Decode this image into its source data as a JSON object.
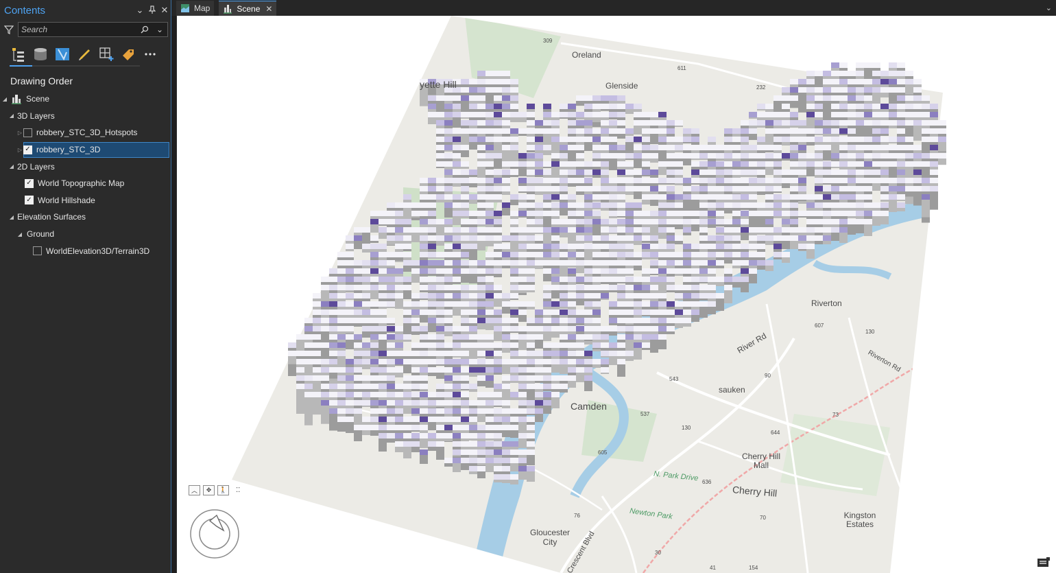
{
  "contents": {
    "title": "Contents",
    "search": {
      "placeholder": "Search"
    },
    "section_title": "Drawing Order",
    "tree": {
      "scene": "Scene",
      "layers_3d": "3D Layers",
      "hotspots": "robbery_STC_3D_Hotspots",
      "stc3d": "robbery_STC_3D",
      "layers_2d": "2D Layers",
      "topo": "World Topographic Map",
      "hillshade": "World Hillshade",
      "elevation": "Elevation Surfaces",
      "ground": "Ground",
      "terrain": "WorldElevation3D/Terrain3D"
    },
    "checked": {
      "hotspots": false,
      "stc3d": true,
      "topo": true,
      "hillshade": true,
      "terrain": false
    }
  },
  "tabs": [
    {
      "label": "Map"
    },
    {
      "label": "Scene"
    }
  ],
  "map_labels": {
    "oreland": "Oreland",
    "glenside": "Glenside",
    "hill": "yette Hill",
    "riverton": "Riverton",
    "river_rd": "River Rd",
    "riverton_rd": "Riverton Rd",
    "camden": "Camden",
    "pennsauken": "sauken",
    "cherry_hill_mall": "Cherry Hill Mall",
    "cherry_hill": "Cherry Hill",
    "park_drive": "N. Park Drive",
    "newton_park": "Newton Park",
    "kingston": "Kingston Estates",
    "gloucester": "Gloucester City",
    "crescent": "Crescent Blvd",
    "rt309": "309",
    "rt611": "611",
    "rt232": "232",
    "rt607": "607",
    "rt130a": "130",
    "rt543": "543",
    "rt90": "90",
    "rt537": "537",
    "rt130b": "130",
    "rt73": "73",
    "rt644": "644",
    "rt605": "605",
    "rt636": "636",
    "rt70": "70",
    "rt76": "76",
    "rt30": "30",
    "rt41": "41",
    "rt154": "154"
  },
  "colors": {
    "accent": "#4ea3f2",
    "selected_row": "#1e4a73",
    "water": "#a6cde6",
    "land": "#ecebe6",
    "column_light": "#f4f3f9",
    "column_dark": "#5d4a9a"
  }
}
